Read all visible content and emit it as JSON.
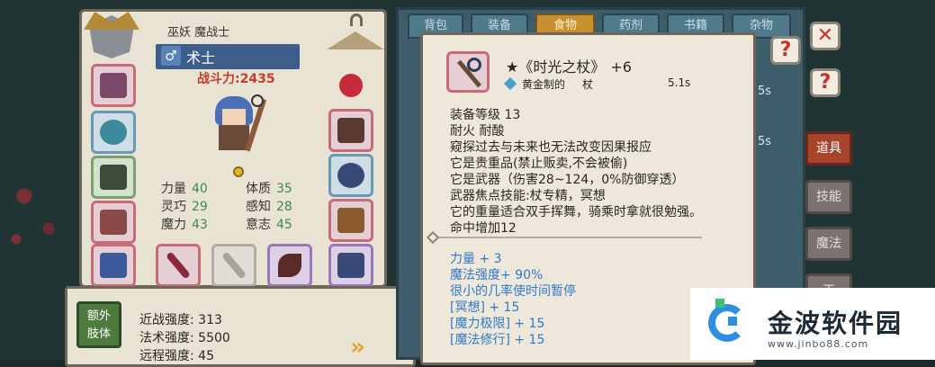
{
  "character": {
    "class_line": "巫妖 魔战士",
    "class_name": "术士",
    "gender_icon": "♂",
    "power": "战斗力:2435",
    "attributes": [
      {
        "label": "力量",
        "value": "40"
      },
      {
        "label": "体质",
        "value": "35"
      },
      {
        "label": "灵巧",
        "value": "29"
      },
      {
        "label": "感知",
        "value": "28"
      },
      {
        "label": "魔力",
        "value": "43"
      },
      {
        "label": "意志",
        "value": "45"
      }
    ]
  },
  "stats": {
    "limb_button": "额外\n肢体",
    "melee": "近战强度: 313",
    "spell": "法术强度: 5500",
    "ranged": "远程强度: 45"
  },
  "tabs": [
    "背包",
    "装备",
    "食物",
    "药剂",
    "书籍",
    "杂物"
  ],
  "inventory_times": [
    "5s",
    "5s"
  ],
  "side_tabs": [
    "道具",
    "技能",
    "魔法",
    "工"
  ],
  "tooltip": {
    "title": "★《时光之杖》",
    "enhance": "+6",
    "material": "黄金制的",
    "type": "杖",
    "weight": "5.1s",
    "lines": [
      "装备等级 13",
      "耐火  耐酸",
      "窥探过去与未来也无法改变因果报应",
      "它是贵重品(禁止贩卖,不会被偷)",
      "它是武器（伤害28~124，0%防御穿透）",
      "武器焦点技能:杖专精，冥想",
      "它的重量适合双手挥舞，骑乘时拿就很勉强。",
      "命中增加12"
    ],
    "bonuses": [
      "力量 + 3",
      "魔法强度+ 90%",
      "很小的几率使时间暂停",
      "[冥想] + 15",
      "[魔力极限] + 15",
      "[魔法修行] + 15"
    ]
  },
  "corner_buttons": [
    "?",
    "✕",
    "?",
    "?"
  ],
  "watermark": {
    "name": "金波软件园",
    "url": "www.jinbo88.com"
  }
}
